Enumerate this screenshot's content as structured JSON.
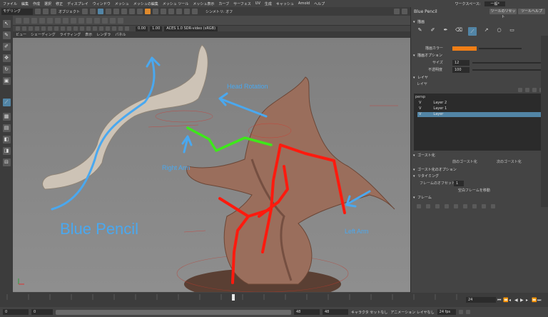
{
  "menubar": {
    "items": [
      "ファイル",
      "編集",
      "作成",
      "選択",
      "修正",
      "ディスプレイ",
      "ウィンドウ",
      "メッシュ",
      "メッシュの編集",
      "メッシュ ツール",
      "メッシュ表示",
      "カーブ",
      "サーフェス",
      "UV",
      "生成",
      "キャッシュ",
      "Arnold",
      "ヘルプ"
    ],
    "workspace_label": "ワークスペース:",
    "workspace_value": "一般*"
  },
  "statusline": {
    "mode": "モデリング",
    "object_mode": "オブジェクト",
    "symmetry": "シンメトリ: オフ"
  },
  "viewport_menu": [
    "ビュー",
    "シェーディング",
    "ライティング",
    "表示",
    "レンダラ",
    "パネル"
  ],
  "viewport_toolbar": {
    "value_a": "0.00",
    "value_b": "1.00",
    "color_space": "ACES 1.0 SDR-video (sRGB)"
  },
  "annotations": {
    "title": "Blue Pencil",
    "head_rotation": "Head Rotation",
    "right_arm": "Right Arm",
    "left_arm": "Left Arm"
  },
  "panel": {
    "title": "Blue Pencil",
    "tool_button": "ツールのリセット",
    "help_button": "ツールヘルプ",
    "sections": {
      "tools": "描画",
      "brush": "描画オプション",
      "layers": "レイヤ",
      "ghost": "ゴースト化",
      "ghost_options": "ゴースト化のオプション",
      "retime": "リタイミング",
      "frame": "フレーム"
    },
    "brush_color_label": "描画カラー",
    "brush_color": "#f07e16",
    "size_label": "サイズ",
    "size_value": "12",
    "opacity_label": "不透明度",
    "opacity_value": "100",
    "layer_label": "レイヤ",
    "camera_name": "persp",
    "layers": [
      {
        "vis": "V",
        "name": "Layer 2"
      },
      {
        "vis": "V",
        "name": "Layer 1"
      },
      {
        "vis": "V",
        "name": "Layer"
      }
    ],
    "ghost_prev": "前のゴースト化",
    "ghost_next": "次のゴースト化",
    "frame_label": "フレームのオフセット",
    "frame_value": "1",
    "frame_check": "空白フレームを移動"
  },
  "timeline": {
    "current_frame": "24",
    "range_start": "0",
    "range_inner_start": "0",
    "range_inner_end": "48",
    "range_end": "48",
    "char_set": "キャラクタ セットなし",
    "anim_layer": "アニメーション レイヤなし",
    "fps": "24 fps"
  },
  "colors": {
    "accent": "#5285a6",
    "blue_pencil": "#4aa8ef",
    "red_stroke": "#ff1a0e",
    "green_stroke": "#3ee81a"
  }
}
